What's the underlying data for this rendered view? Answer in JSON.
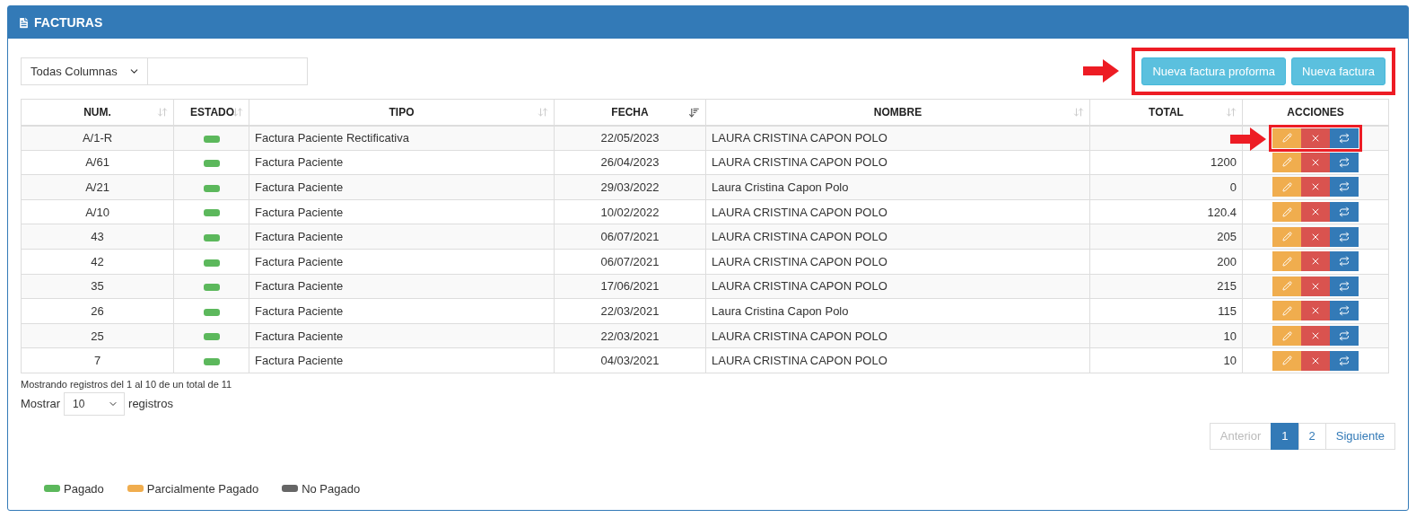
{
  "panel": {
    "title": "FACTURAS"
  },
  "filter": {
    "column": "Todas Columnas"
  },
  "toolbar": {
    "highlighted": true,
    "buttons": [
      "Nueva factura proforma",
      "Nueva factura"
    ]
  },
  "table": {
    "columns": [
      {
        "label": "NUM.",
        "sortable": true,
        "sorted": false
      },
      {
        "label": "ESTADO",
        "sortable": true,
        "sorted": false
      },
      {
        "label": "TIPO",
        "sortable": true,
        "sorted": false
      },
      {
        "label": "FECHA",
        "sortable": true,
        "sorted": true
      },
      {
        "label": "NOMBRE",
        "sortable": true,
        "sorted": false
      },
      {
        "label": "TOTAL",
        "sortable": true,
        "sorted": false
      },
      {
        "label": "ACCIONES",
        "sortable": false
      }
    ],
    "rows": [
      {
        "num": "A/1-R",
        "color": "#5cb85c",
        "tipo": "Factura Paciente Rectificativa",
        "fecha": "22/05/2023",
        "nombre": "LAURA CRISTINA CAPON POLO",
        "total": "",
        "highlighted": true
      },
      {
        "num": "A/61",
        "color": "#5cb85c",
        "tipo": "Factura Paciente",
        "fecha": "26/04/2023",
        "nombre": "LAURA CRISTINA CAPON POLO",
        "total": "1200",
        "highlighted": false
      },
      {
        "num": "A/21",
        "color": "#5cb85c",
        "tipo": "Factura Paciente",
        "fecha": "29/03/2022",
        "nombre": "Laura Cristina Capon Polo",
        "total": "0",
        "highlighted": false
      },
      {
        "num": "A/10",
        "color": "#5cb85c",
        "tipo": "Factura Paciente",
        "fecha": "10/02/2022",
        "nombre": "LAURA CRISTINA CAPON POLO",
        "total": "120.4",
        "highlighted": false
      },
      {
        "num": "43",
        "color": "#5cb85c",
        "tipo": "Factura Paciente",
        "fecha": "06/07/2021",
        "nombre": "LAURA CRISTINA CAPON POLO",
        "total": "205",
        "highlighted": false
      },
      {
        "num": "42",
        "color": "#5cb85c",
        "tipo": "Factura Paciente",
        "fecha": "06/07/2021",
        "nombre": "LAURA CRISTINA CAPON POLO",
        "total": "200",
        "highlighted": false
      },
      {
        "num": "35",
        "color": "#5cb85c",
        "tipo": "Factura Paciente",
        "fecha": "17/06/2021",
        "nombre": "LAURA CRISTINA CAPON POLO",
        "total": "215",
        "highlighted": false
      },
      {
        "num": "26",
        "color": "#5cb85c",
        "tipo": "Factura Paciente",
        "fecha": "22/03/2021",
        "nombre": "Laura Cristina Capon Polo",
        "total": "115",
        "highlighted": false
      },
      {
        "num": "25",
        "color": "#5cb85c",
        "tipo": "Factura Paciente",
        "fecha": "22/03/2021",
        "nombre": "LAURA CRISTINA CAPON POLO",
        "total": "10",
        "highlighted": false
      },
      {
        "num": "7",
        "color": "#5cb85c",
        "tipo": "Factura Paciente",
        "fecha": "04/03/2021",
        "nombre": "LAURA CRISTINA CAPON POLO",
        "total": "10",
        "highlighted": false
      }
    ]
  },
  "info": "Mostrando registros del 1 al 10 de un total de 11",
  "length": {
    "prefix": "Mostrar",
    "value": "10",
    "suffix": "registros"
  },
  "pagination": [
    {
      "label": "Anterior",
      "selected": false,
      "disabled": true
    },
    {
      "label": "1",
      "selected": true,
      "disabled": false
    },
    {
      "label": "2",
      "selected": false,
      "disabled": false
    },
    {
      "label": "Siguiente",
      "selected": false,
      "disabled": false
    }
  ],
  "legend": [
    {
      "label": "Pagado",
      "color": "#5cb85c"
    },
    {
      "label": "Parcialmente Pagado",
      "color": "#f0ad4e"
    },
    {
      "label": "No Pagado",
      "color": "#666666"
    }
  ]
}
